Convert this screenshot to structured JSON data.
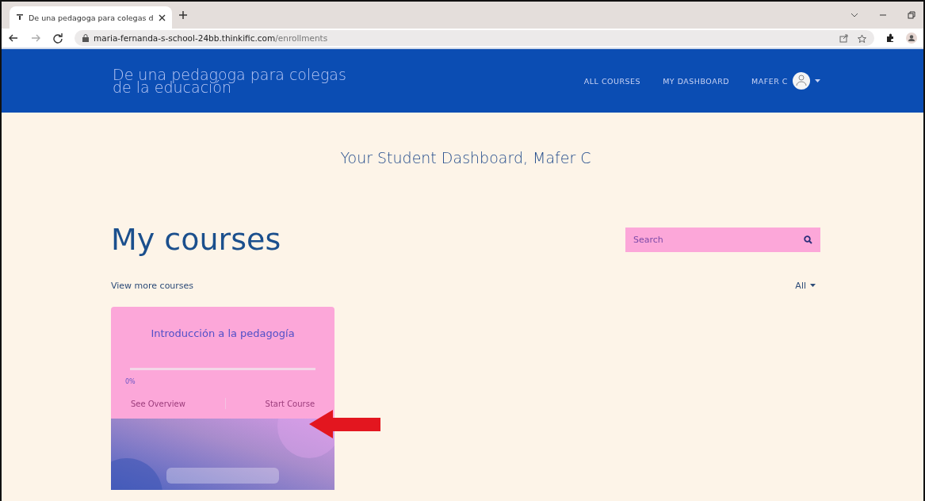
{
  "browser": {
    "tab_title": "De una pedagoga para colegas d",
    "url_host": "maria-fernanda-s-school-24bb.thinkific.com",
    "url_path": "/enrollments"
  },
  "header": {
    "site_title": "De una pedagoga para colegas de la educación",
    "nav": [
      "ALL COURSES",
      "MY DASHBOARD"
    ],
    "user": "MAFER C"
  },
  "dashboard_title": "Your Student Dashboard, Mafer C",
  "heading": "My courses",
  "search": {
    "placeholder": "Search"
  },
  "view_more": "View more courses",
  "filter": "All",
  "courses": [
    {
      "title": "Introducción a la pedagogía",
      "level": 0,
      "progress": "0%",
      "actions": [
        "See Overview",
        "Start Course"
      ]
    }
  ]
}
